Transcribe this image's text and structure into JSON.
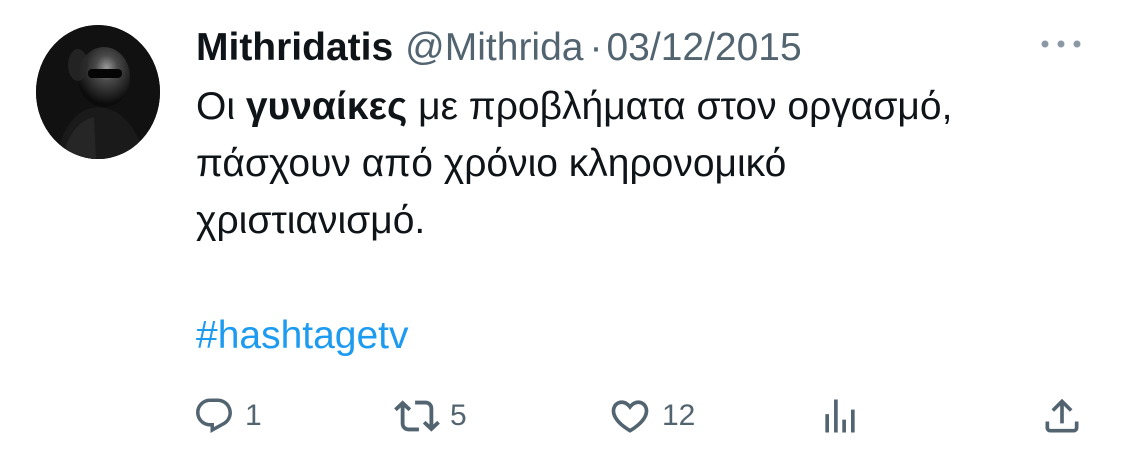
{
  "tweet": {
    "author": {
      "display_name": "Mithridatis",
      "handle": "@Mithrida",
      "avatar_icon": "profile-photo"
    },
    "separator": "·",
    "date": "03/12/2015",
    "menu_icon": "more-horizontal-icon",
    "text": {
      "line1_prefix": "Οι ",
      "line1_bold": "γυναίκες",
      "line1_suffix": " με προβλήματα στον οργασμό,",
      "line2": "πάσχουν από χρόνιο κληρονομικό",
      "line3": "χριστιανισμό."
    },
    "hashtag": "#hashtagetv",
    "actions": {
      "reply": {
        "icon": "reply-icon",
        "count": "1"
      },
      "retweet": {
        "icon": "retweet-icon",
        "count": "5"
      },
      "like": {
        "icon": "heart-icon",
        "count": "12"
      },
      "views": {
        "icon": "analytics-icon"
      },
      "share": {
        "icon": "share-icon"
      }
    },
    "colors": {
      "text": "#0f1419",
      "secondary": "#536471",
      "link": "#1d9bf0",
      "background": "#ffffff"
    }
  }
}
